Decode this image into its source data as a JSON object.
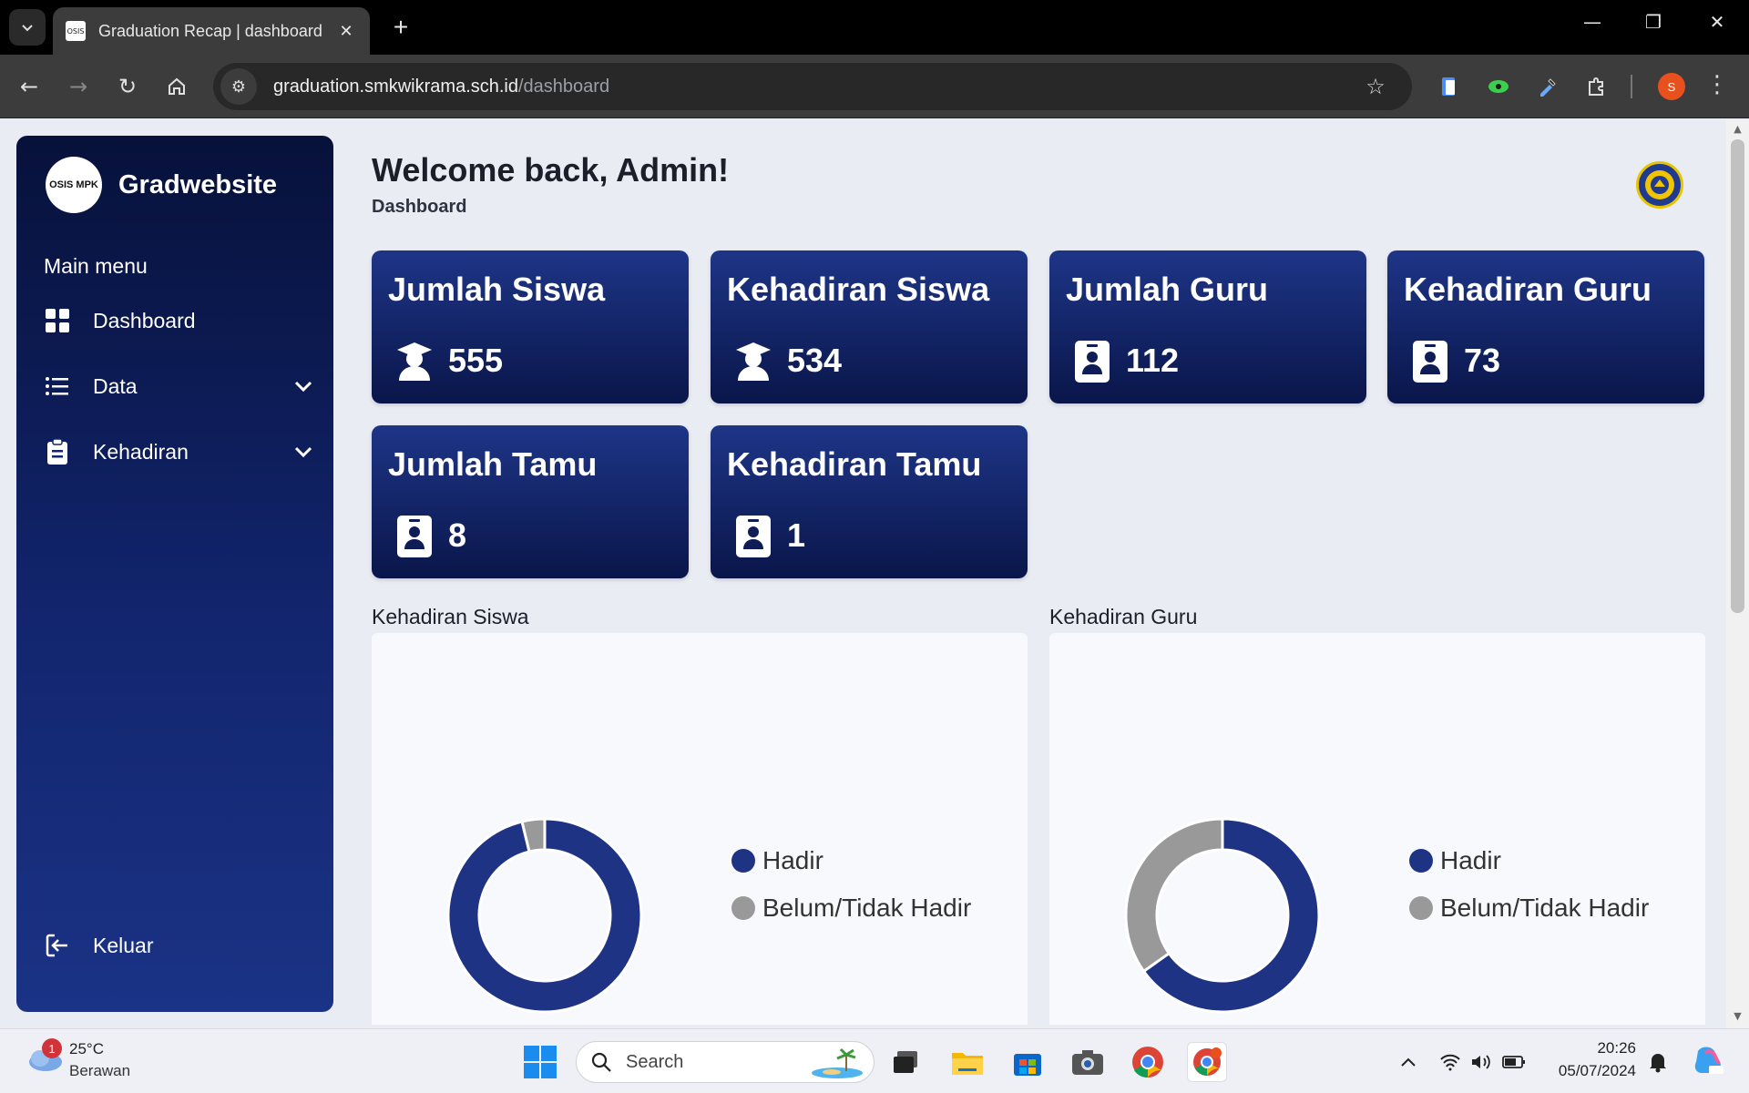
{
  "browser": {
    "tab_title": "Graduation Recap | dashboard",
    "tab_favicon_text": "OSIS",
    "url_host": "graduation.smkwikrama.sch.id",
    "url_path": "/dashboard",
    "profile_initial": "S"
  },
  "sidebar": {
    "brand_name": "Gradwebsite",
    "brand_logo_text": "OSIS MPK",
    "menu_heading": "Main menu",
    "items": [
      {
        "label": "Dashboard",
        "icon": "grid-icon"
      },
      {
        "label": "Data",
        "icon": "list-icon"
      },
      {
        "label": "Kehadiran",
        "icon": "clipboard-icon"
      }
    ],
    "logout_label": "Keluar"
  },
  "header": {
    "welcome": "Welcome back, Admin!",
    "breadcrumb": "Dashboard"
  },
  "cards": [
    {
      "title": "Jumlah Siswa",
      "value": "555",
      "icon": "student-icon"
    },
    {
      "title": "Kehadiran Siswa",
      "value": "534",
      "icon": "student-icon"
    },
    {
      "title": "Jumlah Guru",
      "value": "112",
      "icon": "id-badge-icon"
    },
    {
      "title": "Kehadiran Guru",
      "value": "73",
      "icon": "id-badge-icon"
    },
    {
      "title": "Jumlah Tamu",
      "value": "8",
      "icon": "id-badge-icon"
    },
    {
      "title": "Kehadiran Tamu",
      "value": "1",
      "icon": "id-badge-icon"
    }
  ],
  "colors": {
    "hadir": "#1e3384",
    "belum": "#999999",
    "card_top": "#1e3587",
    "card_bottom": "#0a164a"
  },
  "chart_data": [
    {
      "type": "pie",
      "title": "Kehadiran Siswa",
      "labels": [
        "Hadir",
        "Belum/Tidak Hadir"
      ],
      "values": [
        534,
        21
      ]
    },
    {
      "type": "pie",
      "title": "Kehadiran Guru",
      "labels": [
        "Hadir",
        "Belum/Tidak Hadir"
      ],
      "values": [
        73,
        39
      ]
    }
  ],
  "taskbar": {
    "temp": "25°C",
    "weather": "Berawan",
    "weather_badge": "1",
    "search_placeholder": "Search",
    "time": "20:26",
    "date": "05/07/2024"
  }
}
